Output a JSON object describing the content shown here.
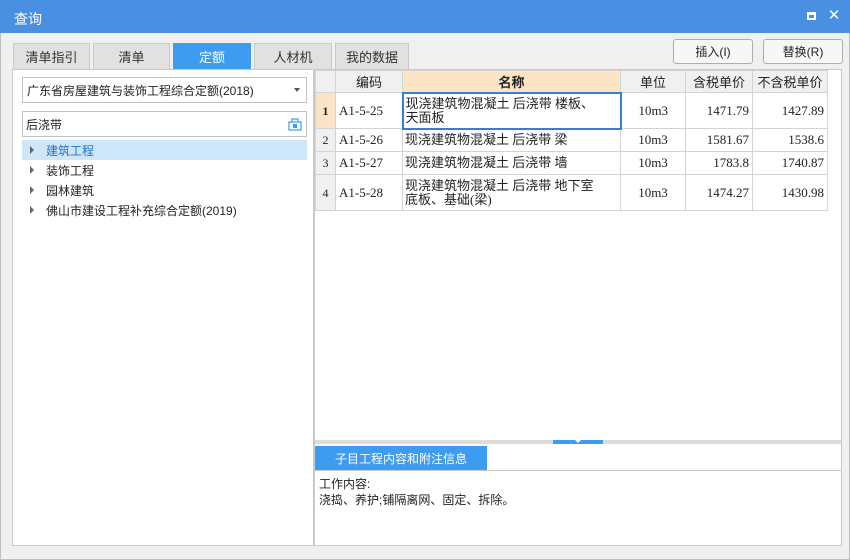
{
  "window": {
    "title": "查询",
    "maximize_icon": "maximize-icon",
    "close_icon": "close-icon",
    "accent": "#4a90e2"
  },
  "tabs": [
    {
      "label": "清单指引",
      "active": false
    },
    {
      "label": "清单",
      "active": false
    },
    {
      "label": "定额",
      "active": true
    },
    {
      "label": "人材机",
      "active": false
    },
    {
      "label": "我的数据",
      "active": false
    }
  ],
  "actions": {
    "insert_label": "插入(I)",
    "replace_label": "替换(R)"
  },
  "left": {
    "library_selected": "广东省房屋建筑与装饰工程综合定额(2018)",
    "search_value": "后浇带",
    "search_icon": "search-icon",
    "tree": [
      {
        "label": "建筑工程",
        "selected": true
      },
      {
        "label": "装饰工程",
        "selected": false
      },
      {
        "label": "园林建筑",
        "selected": false
      },
      {
        "label": "佛山市建设工程补充综合定额(2019)",
        "selected": false
      }
    ]
  },
  "grid": {
    "headers": {
      "code": "编码",
      "name": "名称",
      "unit": "单位",
      "tax_price": "含税单价",
      "notax_price": "不含税单价"
    },
    "rows": [
      {
        "no": "1",
        "code": "A1-5-25",
        "name_line1": "现浇建筑物混凝土 后浇带 楼板、",
        "name_line2": "天面板",
        "unit": "10m3",
        "tax_price": "1471.79",
        "notax_price": "1427.89"
      },
      {
        "no": "2",
        "code": "A1-5-26",
        "name_line1": "现浇建筑物混凝土 后浇带 梁",
        "name_line2": "",
        "unit": "10m3",
        "tax_price": "1581.67",
        "notax_price": "1538.6"
      },
      {
        "no": "3",
        "code": "A1-5-27",
        "name_line1": "现浇建筑物混凝土 后浇带 墙",
        "name_line2": "",
        "unit": "10m3",
        "tax_price": "1783.8",
        "notax_price": "1740.87"
      },
      {
        "no": "4",
        "code": "A1-5-28",
        "name_line1": "现浇建筑物混凝土 后浇带 地下室",
        "name_line2": "底板、基础(梁)",
        "unit": "10m3",
        "tax_price": "1474.27",
        "notax_price": "1430.98"
      }
    ]
  },
  "info": {
    "tab_label": "子目工程内容和附注信息",
    "content_title": "工作内容:",
    "content_text": "浇捣、养护;铺隔离网、固定、拆除。"
  }
}
